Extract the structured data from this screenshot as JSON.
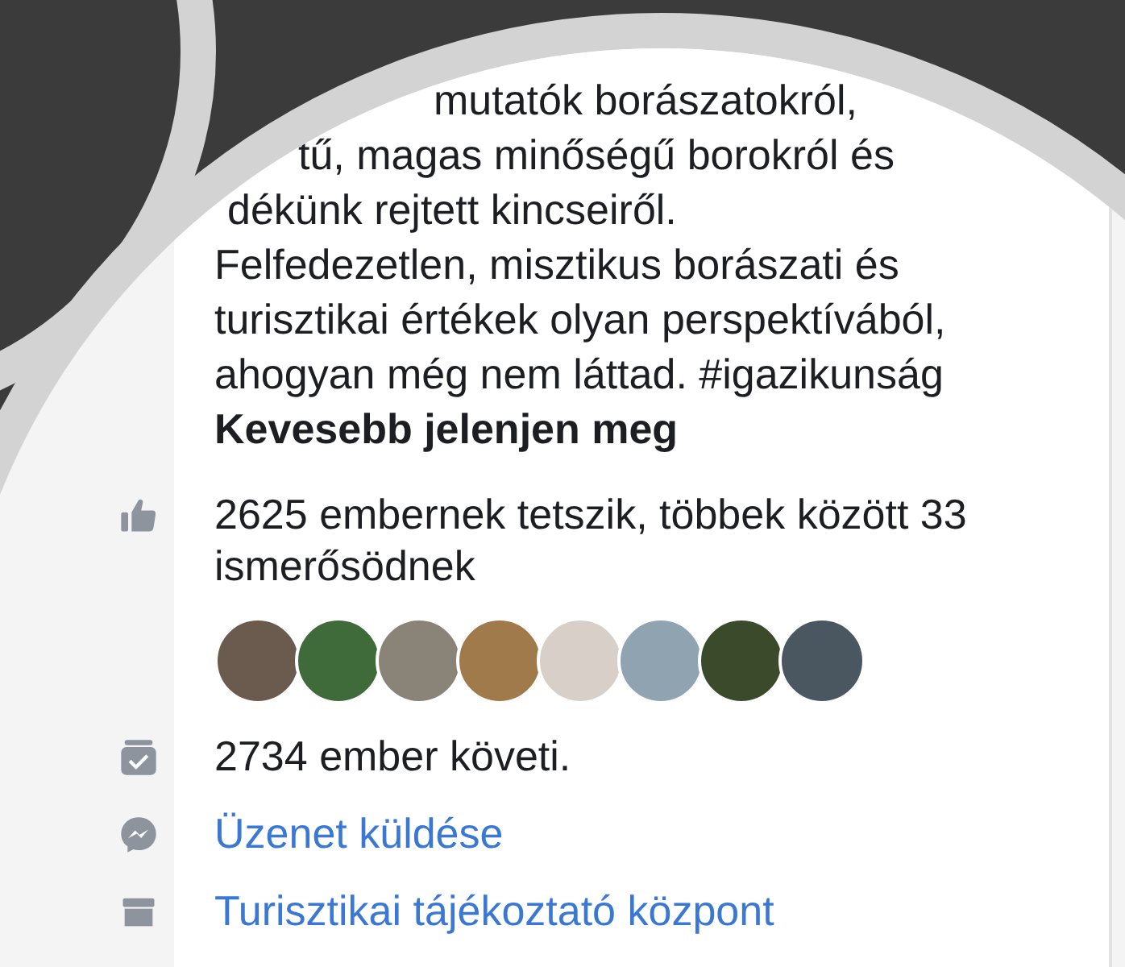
{
  "description": {
    "lines": [
      "mutatók borászatokról,",
      "tű, magas minőségű borokról és",
      "dékünk rejtett kincseiről.",
      "Felfedezetlen, misztikus borászati és",
      "turisztikai értékek olyan perspektívából,",
      "ahogyan még nem láttad. #igazikunság"
    ],
    "toggle": "Kevesebb jelenjen meg"
  },
  "rows": [
    {
      "kind": "likes",
      "text": "2625 embernek tetszik, többek között 33 ismerősödnek"
    },
    {
      "kind": "avatars",
      "avatars": [
        {
          "color": "#6b5a4e"
        },
        {
          "color": "#3f6a3a"
        },
        {
          "color": "#8a8478"
        },
        {
          "color": "#a07a4a"
        },
        {
          "color": "#d8d0c8"
        },
        {
          "color": "#8fa3b0"
        },
        {
          "color": "#3c4a2c"
        },
        {
          "color": "#4a5660"
        }
      ]
    },
    {
      "kind": "follows",
      "text": "2734 ember követi."
    },
    {
      "kind": "message",
      "text": "Üzenet küldése"
    },
    {
      "kind": "place",
      "text": "Turisztikai tájékoztató központ"
    }
  ]
}
